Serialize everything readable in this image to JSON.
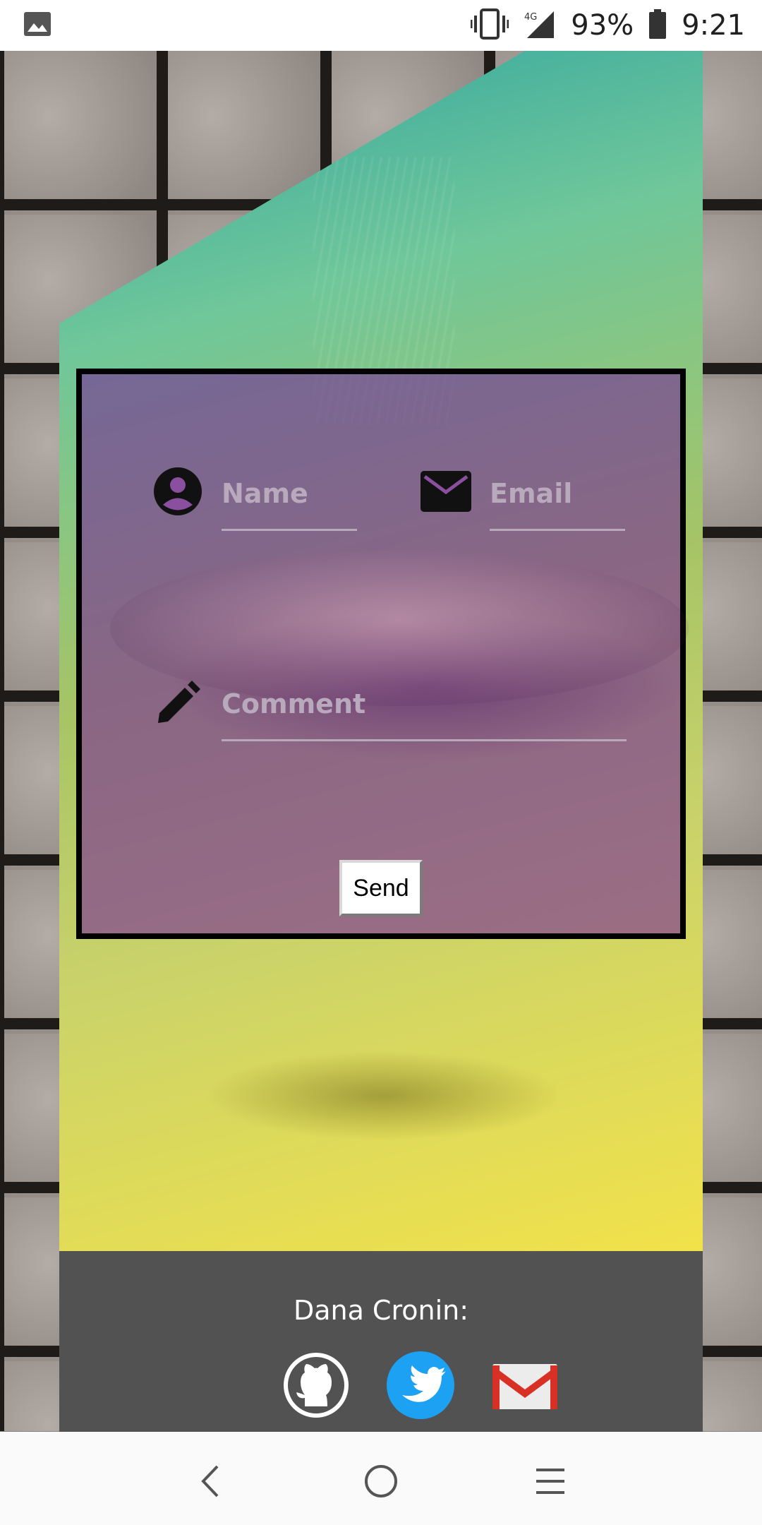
{
  "status_bar": {
    "battery": "93%",
    "time": "9:21",
    "network": "4G LTE",
    "icons": [
      "image-icon",
      "vibrate-icon",
      "signal-icon",
      "battery-icon"
    ]
  },
  "form": {
    "name_placeholder": "Name",
    "email_placeholder": "Email",
    "comment_placeholder": "Comment",
    "send_label": "Send",
    "icons": [
      "account-circle-icon",
      "mail-icon",
      "pencil-icon"
    ]
  },
  "footer": {
    "name": "Dana Cronin:",
    "links": [
      {
        "icon": "github-icon"
      },
      {
        "icon": "twitter-icon"
      },
      {
        "icon": "gmail-icon"
      }
    ]
  },
  "nav": {
    "buttons": [
      "back-icon",
      "home-icon",
      "menu-icon"
    ]
  },
  "colors": {
    "form_overlay": "#782d96",
    "footer_bg": "#525252",
    "twitter_blue": "#1da1f2",
    "gmail_red": "#d93025"
  }
}
